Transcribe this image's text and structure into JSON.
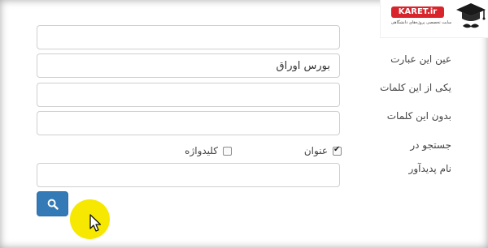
{
  "form": {
    "fields": [
      {
        "value": "",
        "placeholder": ""
      },
      {
        "value": "بورس اوراق",
        "placeholder": ""
      },
      {
        "value": "",
        "placeholder": ""
      },
      {
        "value": "",
        "placeholder": ""
      },
      {
        "value": "",
        "placeholder": ""
      }
    ],
    "labels": {
      "exact_phrase": "عین این عبارت",
      "any_words": "یکی از این کلمات",
      "without_words": "بدون این کلمات",
      "search_in": "جستجو در",
      "creator_name": "نام پدیدآور"
    },
    "checkboxes": [
      {
        "label": "عنوان",
        "checked": true
      },
      {
        "label": "کلیدواژه",
        "checked": false
      }
    ],
    "search_button": {
      "icon": "search-icon"
    }
  },
  "watermark": {
    "brand": "KARET.ir",
    "tagline": "سایت تخصصی پروژه‌های دانشگاهی",
    "icon": "graduation-cap-icon"
  },
  "colors": {
    "button": "#337ab7",
    "brand_red": "#d8242b",
    "cursor_highlight": "#f6e800"
  }
}
